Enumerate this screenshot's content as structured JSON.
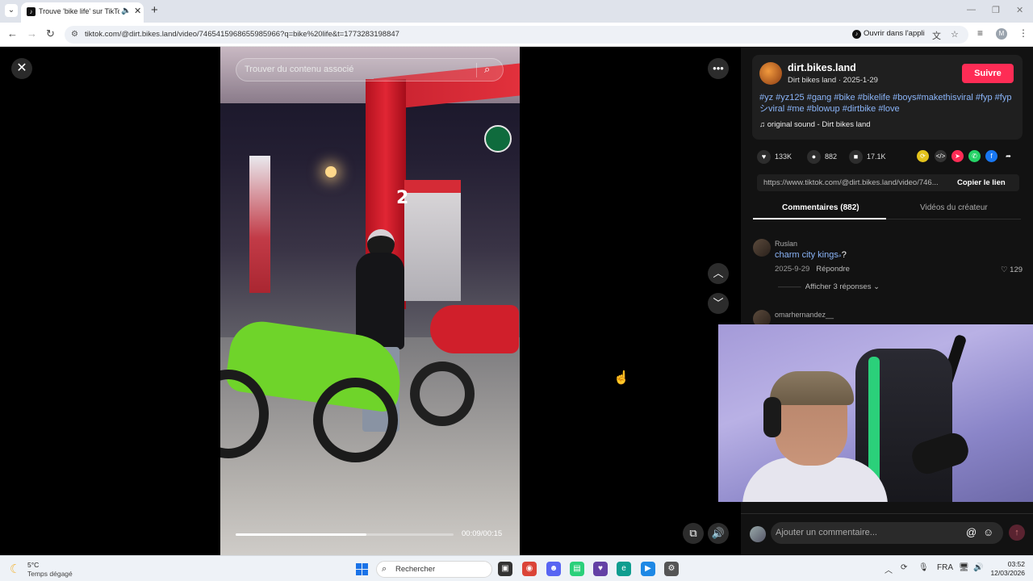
{
  "browser": {
    "tab_title": "Trouve 'bike life' sur TikTok",
    "url": "tiktok.com/@dirt.bikes.land/video/7465415968655985966?q=bike%20life&t=1773283198847",
    "open_app_label": "Ouvrir dans l'appli"
  },
  "video": {
    "search_placeholder": "Trouver du contenu associé",
    "timecode": "00:09/00:15",
    "progress_fraction": 0.6,
    "scene_sign_number": "2"
  },
  "creator": {
    "username": "dirt.bikes.land",
    "subline": "Dirt bikes land · 2025-1-29",
    "follow_label": "Suivre",
    "hashtags": "#yz #yz125 #gang #bike #bikelife #boys#makethisviral #fyp #fypシviral #me #blowup #dirtbike #love",
    "sound": "original sound - Dirt bikes land"
  },
  "stats": {
    "likes": "133K",
    "comments": "882",
    "saves": "17.1K"
  },
  "share": {
    "link": "https://www.tiktok.com/@dirt.bikes.land/video/746...",
    "copy_label": "Copier le lien",
    "icons": [
      "repost-icon",
      "embed-icon",
      "send-icon",
      "whatsapp-icon",
      "facebook-icon",
      "share-arrow-icon"
    ]
  },
  "panel_tabs": {
    "comments": "Commentaires (882)",
    "creator_videos": "Vidéos du créateur"
  },
  "comments": [
    {
      "user": "Ruslan",
      "text": "charm city kings",
      "suffix": "?",
      "date": "2025-9-29",
      "reply_label": "Répondre",
      "likes": "129",
      "show_replies": "Afficher 3 réponses"
    },
    {
      "user": "omarhernandez__"
    }
  ],
  "comment_bar": {
    "placeholder": "Ajouter un commentaire..."
  },
  "taskbar": {
    "temperature": "5°C",
    "weather": "Temps dégagé",
    "search": "Rechercher",
    "language": "FRA",
    "time": "03:52",
    "date": "12/03/2026"
  },
  "colors": {
    "follow": "#fe2c55",
    "hashtag": "#8ab4f8",
    "panel_bg": "#121212",
    "page_bg": "#000000"
  }
}
